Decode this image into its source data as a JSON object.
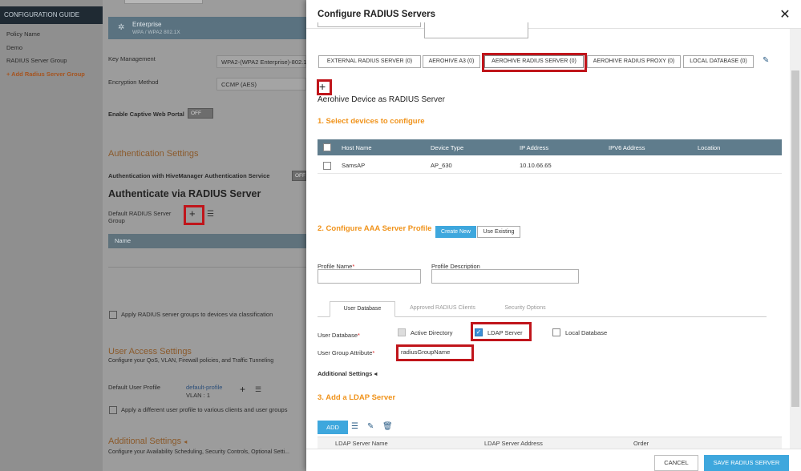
{
  "background": {
    "nav": {
      "header": "CONFIGURATION GUIDE",
      "items": [
        "Policy Name",
        "Demo",
        "RADIUS Server Group",
        "+ Add Radius Server Group"
      ]
    },
    "ssid_tab": {
      "title": "Enterprise",
      "subtitle": "WPA / WPA2 802.1X"
    },
    "key_mgmt": {
      "label": "Key Management",
      "value": "WPA2-(WPA2 Enterprise)-802.1..."
    },
    "encryption": {
      "label": "Encryption Method",
      "value": "CCMP (AES)"
    },
    "captive": {
      "label": "Enable Captive Web Portal",
      "toggle": "OFF"
    },
    "auth_settings": "Authentication Settings",
    "hivemanager_auth": {
      "label": "Authentication with HiveManager Authentication Service",
      "toggle": "OFF"
    },
    "auth_via_radius": "Authenticate via RADIUS Server",
    "default_group": {
      "label_line1": "Default RADIUS Server",
      "label_line2": "Group"
    },
    "table_name_col": "Name",
    "apply_groups": "Apply RADIUS server groups to devices via classification",
    "user_access": {
      "title": "User Access Settings",
      "desc": "Configure your QoS, VLAN, Firewall policies, and Traffic Tunneling"
    },
    "default_profile": {
      "label": "Default User Profile",
      "link": "default-profile",
      "vlan": "VLAN : 1"
    },
    "apply_profile": "Apply a different user profile to various clients and user groups",
    "additional": {
      "title": "Additional Settings",
      "desc": "Configure your Availability Scheduling, Security Controls, Optional Setti..."
    }
  },
  "modal": {
    "title": "Configure RADIUS Servers",
    "server_tabs": [
      "EXTERNAL RADIUS SERVER  (0)",
      "AEROHIVE A3  (0)",
      "AEROHIVE RADIUS SERVER (0)",
      "AEROHIVE RADIUS PROXY  (0)",
      "LOCAL DATABASE  (0)"
    ],
    "device_heading": "Aerohive Device as RADIUS Server",
    "step1": "1. Select devices to configure",
    "device_table": {
      "headers": [
        "Host Name",
        "Device Type",
        "IP Address",
        "IPV6 Address",
        "Location"
      ],
      "rows": [
        {
          "host": "SamsAP",
          "type": "AP_630",
          "ip": "10.10.66.65",
          "ipv6": "",
          "location": ""
        }
      ]
    },
    "step2": "2. Configure AAA Server Profile",
    "create_new": "Create New",
    "use_existing": "Use Existing",
    "profile_name_label": "Profile Name",
    "profile_desc_label": "Profile Description",
    "sub_tabs": [
      "User Database",
      "Approved RADIUS Clients",
      "Security Options"
    ],
    "user_db_label": "User Database",
    "db_options": [
      "Active Directory",
      "LDAP Server",
      "Local Database"
    ],
    "user_group_attr_label": "User Group Attribute",
    "user_group_attr_value": "radiusGroupName",
    "additional_settings": "Additional Settings",
    "step3": "3. Add a LDAP Server",
    "add_button": "ADD",
    "ldap_headers": [
      "LDAP Server Name",
      "LDAP Server Address",
      "Order"
    ],
    "cancel": "CANCEL",
    "save": "SAVE RADIUS SERVER"
  },
  "colors": {
    "accent": "#3ea7dd",
    "section": "#f0931b",
    "highlight": "#c0151b",
    "table_header": "#5f7c8c"
  }
}
